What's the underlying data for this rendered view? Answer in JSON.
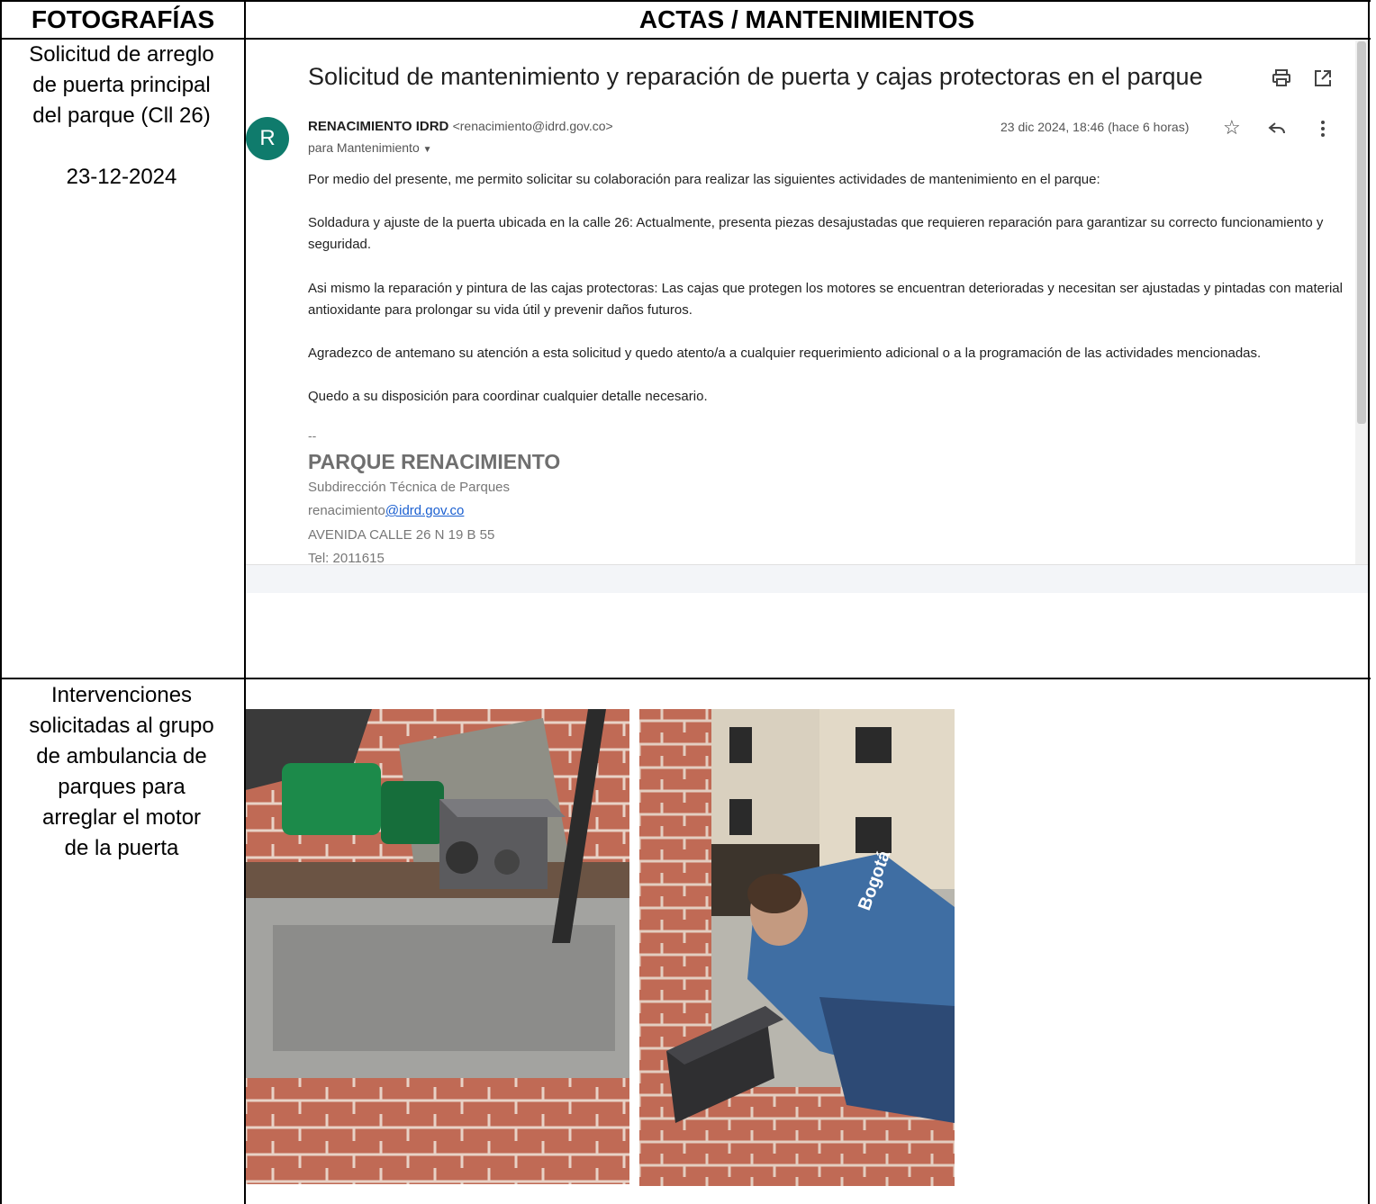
{
  "headers": {
    "left": "FOTOGRAFÍAS",
    "right": "ACTAS / MANTENIMIENTOS"
  },
  "row1": {
    "desc_lines": [
      "Solicitud de arreglo",
      "de puerta principal",
      "del parque (Cll 26)"
    ],
    "date": "23-12-2024"
  },
  "email": {
    "subject": "Solicitud de mantenimiento y reparación de puerta y cajas protectoras en el parque",
    "sender_name": "RENACIMIENTO IDRD",
    "sender_addr": "<renacimiento@idrd.gov.co>",
    "avatar_letter": "R",
    "to": "para Mantenimiento",
    "date": "23 dic 2024, 18:46 (hace 6 horas)",
    "paragraphs": [
      "Por medio del presente, me permito solicitar su colaboración para realizar las siguientes actividades de mantenimiento en el parque:",
      "Soldadura y ajuste de la puerta ubicada en la calle 26: Actualmente, presenta piezas desajustadas que requieren reparación para garantizar su correcto funcionamiento y seguridad.",
      "Asi mismo la reparación y pintura de las cajas protectoras: Las cajas que protegen los motores se encuentran deterioradas y necesitan ser ajustadas y pintadas con material antioxidante para prolongar su vida útil y prevenir daños futuros.",
      "Agradezco de antemano su atención a esta solicitud y quedo atento/a a cualquier requerimiento adicional o a la programación de las actividades mencionadas.",
      "Quedo a su disposición para coordinar cualquier detalle necesario."
    ],
    "signature": {
      "dash": "--",
      "name": "PARQUE RENACIMIENTO",
      "subtitle": "Subdirección Técnica de Parques",
      "email_local": "renacimiento",
      "email_domain": "@idrd.gov.co",
      "address": "AVENIDA CALLE 26 N 19 B 55",
      "tel": "Tel: 2011615"
    },
    "icons": [
      "print-icon",
      "open-in-new-icon",
      "star-icon",
      "reply-icon",
      "more-vert-icon",
      "dropdown-arrow-icon"
    ]
  },
  "row2": {
    "desc_lines": [
      "Intervenciones",
      "solicitadas al grupo",
      "de ambulancia de",
      "parques para",
      "arreglar el motor",
      "de la puerta"
    ],
    "photo_text": "Bogotá"
  },
  "colors": {
    "avatar": "#0f7b6c",
    "link": "#1a5fd0",
    "motor_green": "#1c8a4a",
    "shirt_blue": "#3f6ea3",
    "brick": "#c06a55"
  }
}
